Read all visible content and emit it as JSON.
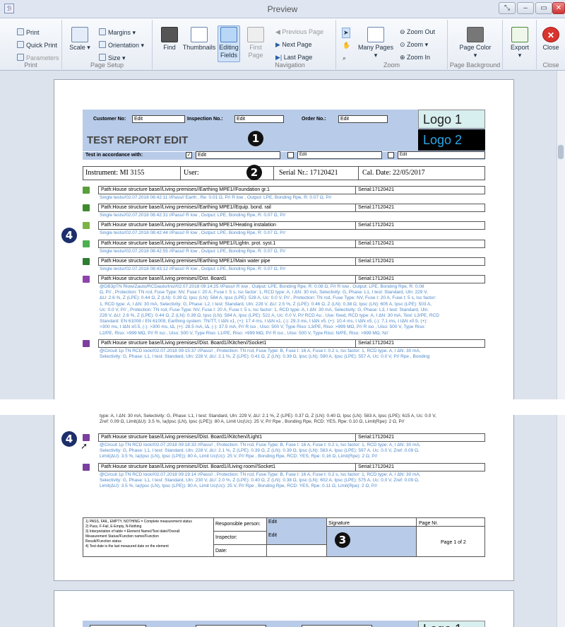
{
  "window": {
    "title": "Preview",
    "buttons": [
      "restore",
      "minimize",
      "maximize",
      "close"
    ]
  },
  "ribbon": {
    "print": {
      "label": "Print",
      "items": [
        "Print",
        "Quick Print",
        "Parameters"
      ]
    },
    "page_setup": {
      "label": "Page Setup",
      "scale": "Scale",
      "margins": "Margins",
      "orientation": "Orientation",
      "size": "Size"
    },
    "find": "Find",
    "thumbnails": "Thumbnails",
    "editing_fields": "Editing Fields",
    "navigation": {
      "label": "Navigation",
      "first": "First Page",
      "previous": "Previous Page",
      "next": "Next Page",
      "last": "Last Page"
    },
    "zoom": {
      "label": "Zoom",
      "many": "Many Pages",
      "zoom_out": "Zoom Out",
      "zoom": "Zoom",
      "zoom_in": "Zoom In"
    },
    "page_background": {
      "label": "Page Background",
      "page_color": "Page Color"
    },
    "export": "Export",
    "close": {
      "label": "Close",
      "button": "Close"
    }
  },
  "report": {
    "customer_no": "Customer No:",
    "inspection_no": "Inspection No.:",
    "order_no": "Order No.:",
    "edit": "Edit",
    "title": "TEST REPORT EDIT",
    "logo1": "Logo 1",
    "logo2": "Logo 2",
    "test_in_accordance": "Test in accordance with:",
    "instrument": "Instrument: MI 3155",
    "user": "User:",
    "serial": "Serial Nr.: 17120421",
    "cal_date": "Cal. Date: 22/05/2017",
    "callouts": [
      "1",
      "2",
      "3",
      "4"
    ],
    "entries": [
      {
        "path": "Path:House structure base//Living premises//Earthing MPE1//Foundation gr.1",
        "serial": "Serial:17120421",
        "icon": "ground-icon",
        "tests": [
          "Single tests//02.07.2018 08:42:11 //Pass// Earth , Re: 0.01 Ω, P// R low , Output: LPE, Bonding Rpe, R: 0.07 Ω, P//"
        ]
      },
      {
        "path": "Path:House structure base//Living premises//Earthing MPE1//Equip. bond. rail",
        "serial": "Serial:17120421",
        "icon": "rail-icon",
        "tests": [
          "Single tests//02.07.2018 08:42:31 //Pass// R low , Output: LPE, Bonding Rpe, R: 0.07 Ω, P//"
        ]
      },
      {
        "path": "Path:House structure base//Living premises//Earthing MPE1//Heating instalation",
        "serial": "Serial:17120421",
        "icon": "heating-icon",
        "tests": [
          "Single tests//02.07.2018 08:42:44 //Pass// R low , Output: LPE, Bonding Rpe, R: 0.07 Ω, P//"
        ]
      },
      {
        "path": "Path:House structure base//Living premises//Earthing MPE1//Lightn. prot. syst.1",
        "serial": "Serial:17120421",
        "icon": "lightning-icon",
        "tests": [
          "Single tests//02.07.2018 08:42:55 //Pass// R low , Output: LPE, Bonding Rpe, R: 0.07 Ω, P//"
        ]
      },
      {
        "path": "Path:House structure base//Living premises//Earthing MPE1//Main water pipe",
        "serial": "Serial:17120421",
        "icon": "water-pipe-icon",
        "tests": [
          "Single tests//02.07.2018 08:43:12 //Pass// R low , Output: LPE, Bonding Rpe, R: 0.07 Ω, P//"
        ]
      },
      {
        "path": "Path:House structure base//Living premises//Dist. Board1",
        "serial": "Serial:17120421",
        "icon": "board-icon",
        "tests": [
          "@DB3pTN Rlow/Zauto/RCDauto/Ins//02.07.2018 09:14:25 //Pass// R low , Output: LPE, Bonding Rpe, R: 0.08 Ω, P// R low , Output: LPE, Bonding Rpe, R: 0.08",
          "Ω, P// , Protection: TN rcd, Fuse Type: NV, Fuse I: 20 A, Fuse t: 5 s, Isc factor: 1, RCD type: A, I ΔN: 30 mA, Selectivity: G, Phase: L1, I test: Standard, Uln: 229 V,",
          "ΔU: 2.6 %, Z (LPE): 0.44 Ω, Z (LN): 0.39 Ω, Ipsc (LN): 584 A, Ipsc (LPE): 528 A, Uc: 0.0 V, P// , Protection: TN rcd, Fuse Type: NV, Fuse I: 20 A, Fuse t: 5 s, Isc factor:",
          "1, RCD type: A, I ΔN: 30 mA, Selectivity: G, Phase: L2, I test: Standard, Uln: 228 V, ΔU: 2.5 %, Z (LPE): 0.46 Ω, Z (LN): 0.38 Ω, Ipsc (LN): 605 A, Ipsc (LPE): 503 A,",
          "Uc: 0.0 V, P// , Protection: TN rcd, Fuse Type: NV, Fuse I: 20 A, Fuse t: 5 s, Isc factor: 1, RCD type: A, I ΔN: 30 mA, Selectivity: G, Phase: L3, I test: Standard, Uln:",
          "228 V, ΔU: 2.6 %, Z (LPE): 0.44 Ω, Z (LN): 0.39 Ω, Ipsc (LN): 584 A, Ipsc (LPE): 521 A, Uc: 0.0 V, P// RCD Au , Use: fixed, RCD type: A, I ΔN: 30 mA, Test: L3/PE, RCD",
          "Standard: EN 61008 / EN 61009, Earthing system: TN/TT, t IΔN x1, (+): 17.4 ms, t IΔN x1, (-): 29.3 ms, t IΔN x5, (+): 10.4 ms, t IΔN x5, (-): 7.1 ms, t IΔN x0.5, (+):",
          ">300 ms, t IΔN x0.5, (-): >300 ms, IΔ, (+): 28.5 mA, IΔ, (-): 37.5 mA, P// R iso , Uiso: 500 V, Type Riso: L3/PE, Riso: >999 MΩ, P// R iso , Uiso: 500 V, Type Riso:",
          "L2/PE, Riso: >999 MΩ, P// R iso , Uiso: 500 V, Type Riso: L1/PE, Riso: >999 MΩ, P// R iso , Uiso: 500 V, Type Riso: N/PE, Riso: >999 MΩ, N//"
        ]
      },
      {
        "path": "Path:House structure base//Living premises//Dist. Board1//Kitchen//Socket1",
        "serial": "Serial:17120421",
        "icon": "socket-icon",
        "tests": [
          "@Circuit 1p TN RCD lock//02.07.2018 09:15:37 //Pass// , Protection: TN rcd, Fuse Type: B, Fuse I: 16 A, Fuse t: 0.2 s, Isc factor: 1, RCD type: A, I ΔN: 30 mA,",
          "Selectivity: G, Phase: L1, I test: Standard, Uln: 228 V, ΔU: 2.1 %, Z (LPE): 0.41 Ω, Z (LN): 0.39 Ω, Ipsc (LN): 590 A, Ipsc (LPE): 557 A, Uc: 0.0 V, P// Rpe , Bonding"
        ]
      }
    ],
    "p2_top_lines": [
      "type: A, I ΔN: 30 mA, Selectivity: G, Phase: L1, I test: Standard, Uln: 229 V, ΔU: 2.1 %, Z (LPE): 0.37 Ω, Z (LN): 0.40 Ω, Ipsc (LN): 583 A, Ipsc (LPE): 615 A, Uc: 0.0 V,",
      "Zref: 0.09 Ω, Limit(ΔU): 3.5 %, Ia(Ipsc (LN), Ipsc (LPE)): 80 A, Limit Uc(Uc): 25 V, P// Rpe , Bonding Rpe, RCD: YES, Rpe: 0.10 Ω, Limit(Rpe): 2 Ω, P//"
    ],
    "p2_entries": [
      {
        "path": "Path:House structure base//Living premises//Dist. Board1//Kitchen//Light1",
        "serial": "Serial:17120421",
        "icon": "light-icon",
        "tests": [
          "@Circuit 1p TN RCD lock//02.07.2018 09:18:33 //Pass// , Protection: TN rcd, Fuse Type: B, Fuse I: 16 A, Fuse t: 0.2 s, Isc factor: 1, RCD type: A, I ΔN: 30 mA,",
          "Selectivity: G, Phase: L1, I test: Standard, Uln: 228 V, ΔU: 2.1 %, Z (LPE): 0.39 Ω, Z (LN): 0.39 Ω, Ipsc (LN): 583 A, Ipsc (LPE): 597 A, Uc: 0.0 V, Zref: 0.09 Ω,",
          "Limit(ΔU): 3.5 %, Ia(Ipsc (LN), Ipsc (LPE)): 80 A, Limit Uc(Uc): 25 V, P// Rpe , Bonding Rpe, RCD: YES, Rpe: 0.16 Ω, Limit(Rpe): 2 Ω, P//"
        ]
      },
      {
        "path": "Path:House structure base//Living premises//Dist. Board1//Living room//Socket1",
        "serial": "Serial:17120421",
        "icon": "socket-icon",
        "tests": [
          "@Circuit 1p TN RCD lock//02.07.2018 09:19:14 //Pass// , Protection: TN rcd, Fuse Type: B, Fuse I: 16 A, Fuse t: 0.2 s, Isc factor: 1, RCD type: A, I ΔN: 30 mA,",
          "Selectivity: G, Phase: L1, I test: Standard, Uln: 230 V, ΔU: 2.0 %, Z (LPE): 0.40 Ω, Z (LN): 0.38 Ω, Ipsc (LN): 602 A, Ipsc (LPE): 575 A, Uc: 0.0 V, Zref: 0.09 Ω,",
          "Limit(ΔU): 3.5 %, Ia(Ipsc (LN), Ipsc (LPE)): 80 A, Limit Uc(Uc): 25 V, P// Rpe , Bonding Rpe, RCD: YES, Rpe: 0.11 Ω, Limit(Rpe): 2 Ω, P//"
        ]
      }
    ],
    "footer": {
      "notes": [
        "1) PASS, FAIL, EMPTY, NOTHING = Complete measurement status",
        "2) Pass, F-Fail, E-Empty, N-Nothing",
        "3) Interpretation of table = Element Name//Test date//Overall",
        "Measurement Status//Function name//Function",
        "Result//Function status",
        "4) Test date is the last measured date on the element"
      ],
      "responsible": "Responsible person:",
      "inspector": "Inspector:",
      "date": "Date:",
      "signature": "Signature",
      "page_nr": "Page Nr.",
      "page_of": "Page 1 of 2"
    }
  }
}
